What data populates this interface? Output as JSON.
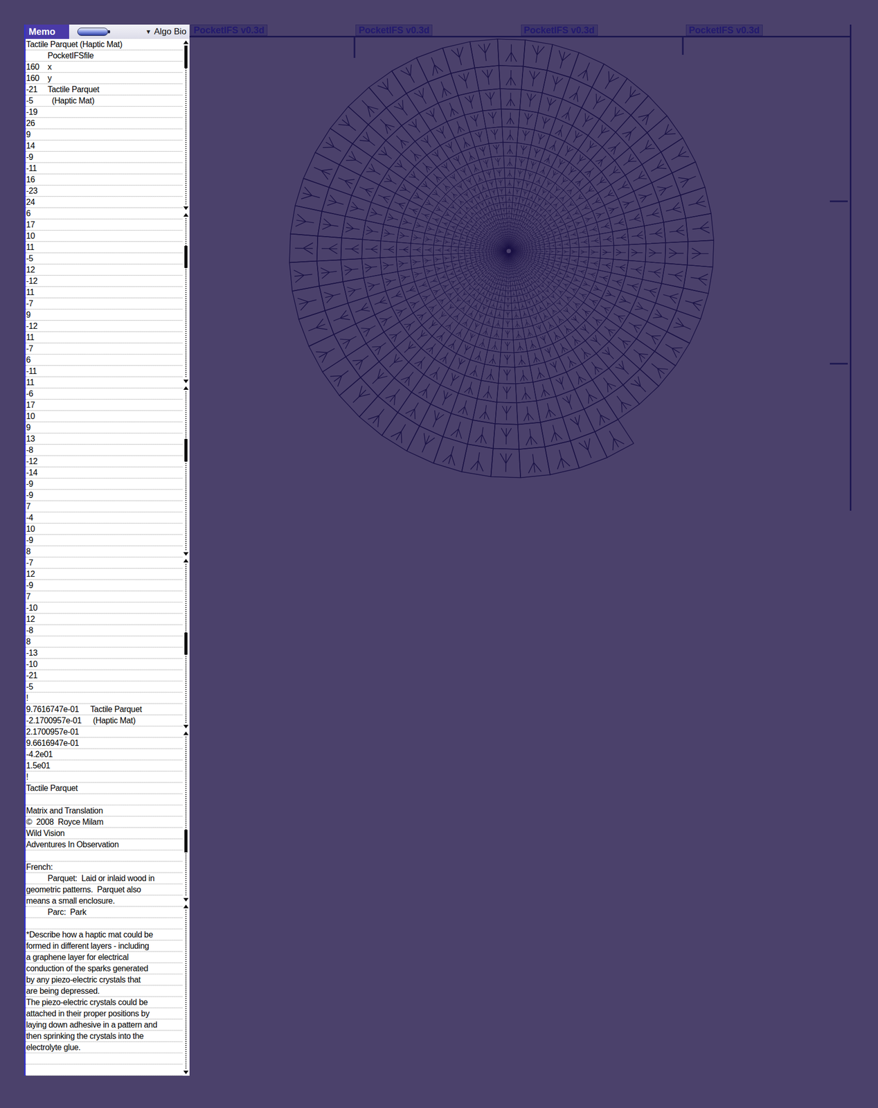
{
  "memo": {
    "title": "Memo",
    "category": "Algo Bio",
    "category_arrow": "▼",
    "lines": [
      {
        "text": "Tactile Parquet (Haptic Mat)"
      },
      {
        "text": "",
        "note": "PocketIFSfile"
      },
      {
        "text": "160",
        "note": "x"
      },
      {
        "text": "160",
        "note": "y"
      },
      {
        "text": "-21",
        "note": "Tactile Parquet"
      },
      {
        "text": "-5",
        "note": "  (Haptic Mat)"
      },
      {
        "text": "-19"
      },
      {
        "text": "26"
      },
      {
        "text": "9"
      },
      {
        "text": "14"
      },
      {
        "text": "-9"
      },
      {
        "text": "-11"
      },
      {
        "text": "16"
      },
      {
        "text": "-23"
      },
      {
        "text": "24"
      },
      {
        "text": "6"
      },
      {
        "text": "17"
      },
      {
        "text": "10"
      },
      {
        "text": "11"
      },
      {
        "text": "-5"
      },
      {
        "text": "12"
      },
      {
        "text": "-12"
      },
      {
        "text": "11"
      },
      {
        "text": "-7"
      },
      {
        "text": "9"
      },
      {
        "text": "-12"
      },
      {
        "text": "11"
      },
      {
        "text": "-7"
      },
      {
        "text": "6"
      },
      {
        "text": "-11"
      },
      {
        "text": "11"
      },
      {
        "text": "-6"
      },
      {
        "text": "17"
      },
      {
        "text": "10"
      },
      {
        "text": "9"
      },
      {
        "text": "13"
      },
      {
        "text": "-8"
      },
      {
        "text": "-12"
      },
      {
        "text": "-14"
      },
      {
        "text": "-9"
      },
      {
        "text": "-9"
      },
      {
        "text": "7"
      },
      {
        "text": "-4"
      },
      {
        "text": "10"
      },
      {
        "text": "-9"
      },
      {
        "text": "8"
      },
      {
        "text": "-7"
      },
      {
        "text": "12"
      },
      {
        "text": "-9"
      },
      {
        "text": "7"
      },
      {
        "text": "-10"
      },
      {
        "text": "12"
      },
      {
        "text": "-8"
      },
      {
        "text": "8"
      },
      {
        "text": "-13"
      },
      {
        "text": "-10"
      },
      {
        "text": "-21"
      },
      {
        "text": "-5"
      },
      {
        "text": "!"
      },
      {
        "text": "9.7616747e-01",
        "note": "    Tactile Parquet"
      },
      {
        "text": "-2.1700957e-01",
        "note": "    (Haptic Mat)"
      },
      {
        "text": "2.1700957e-01"
      },
      {
        "text": "9.6616947e-01"
      },
      {
        "text": "-4.2e01"
      },
      {
        "text": "1.5e01"
      },
      {
        "text": "!"
      },
      {
        "text": "Tactile Parquet"
      },
      {
        "text": ""
      },
      {
        "text": "Matrix and Translation"
      },
      {
        "text": "©  2008  Royce Milam"
      },
      {
        "text": "Wild Vision"
      },
      {
        "text": "Adventures In Observation"
      },
      {
        "text": ""
      },
      {
        "text": "French:"
      },
      {
        "text": "",
        "note": "Parquet:  Laid or inlaid wood in"
      },
      {
        "text": "geometric patterns.  Parquet also"
      },
      {
        "text": "means a small enclosure."
      },
      {
        "text": "",
        "note": "Parc:  Park"
      },
      {
        "text": ""
      },
      {
        "text": "*Describe how a haptic mat could be"
      },
      {
        "text": "formed in different layers - including"
      },
      {
        "text": "a graphene layer for electrical"
      },
      {
        "text": "conduction of the sparks generated"
      },
      {
        "text": "by any piezo-electric crystals that"
      },
      {
        "text": "are being depressed."
      },
      {
        "text": "The piezo-electric crystals could be"
      },
      {
        "text": "attached in their proper positions by"
      },
      {
        "text": "laying down adhesive in a pattern and"
      },
      {
        "text": "then sprinking the crystals into the"
      },
      {
        "text": "electrolyte glue."
      },
      {
        "text": ""
      },
      {
        "text": ""
      }
    ],
    "scroll_segments": [
      {
        "thumb": true,
        "level": 0.0
      },
      {
        "thumb": true,
        "level": 0.2
      },
      {
        "thumb": true,
        "level": 0.35
      },
      {
        "thumb": true,
        "level": 0.5
      },
      {
        "thumb": true,
        "level": 0.68
      },
      {
        "thumb": false,
        "level": 0.0
      }
    ]
  },
  "ifs_windows": [
    {
      "title": "PocketIFS v0.3d"
    },
    {
      "title": "PocketIFS v0.3d"
    },
    {
      "title": "PocketIFS v0.3d"
    },
    {
      "title": "PocketIFS v0.3d"
    }
  ]
}
